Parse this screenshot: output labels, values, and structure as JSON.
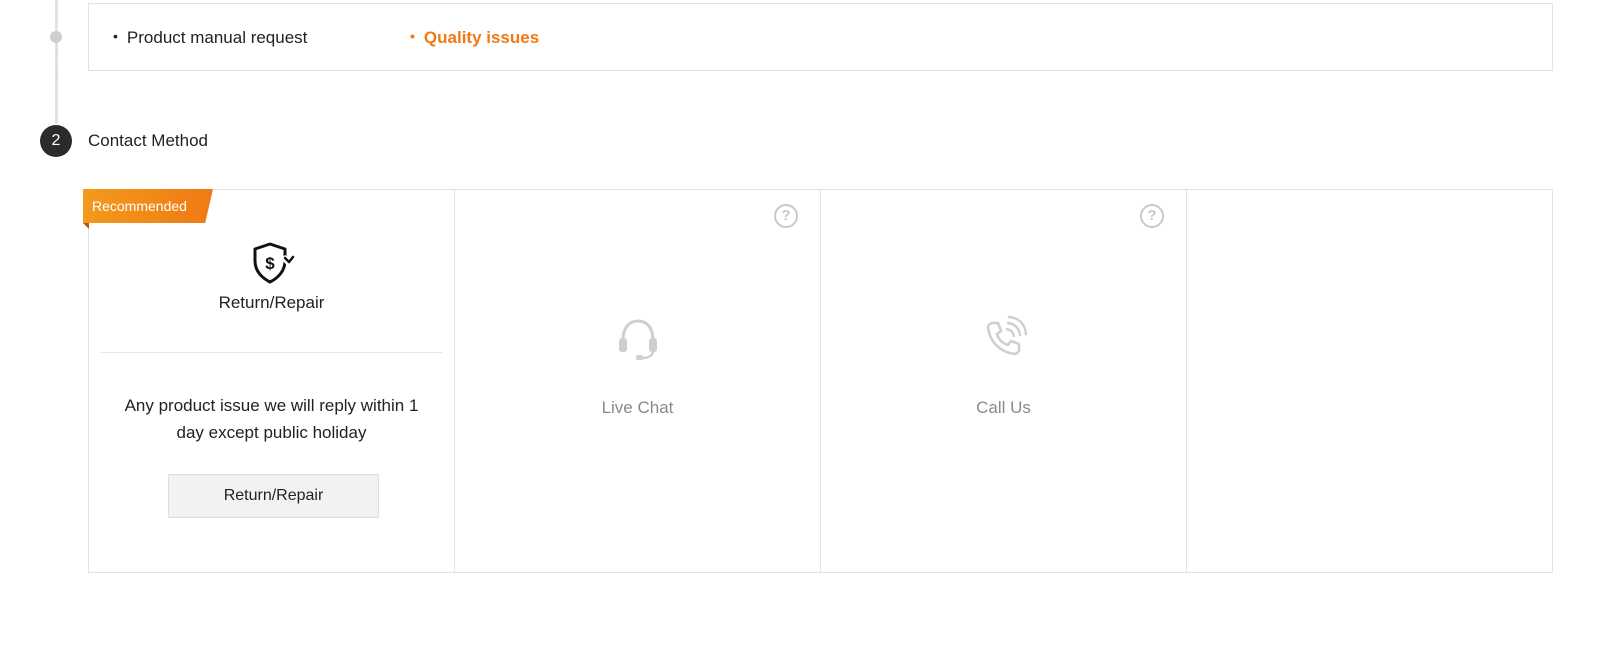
{
  "question_options": [
    {
      "label": "Product manual request",
      "selected": false
    },
    {
      "label": "Quality issues",
      "selected": true
    }
  ],
  "step": {
    "number": "2",
    "label": "Contact Method"
  },
  "contact_methods": [
    {
      "badge": "Recommended",
      "icon": "shield-dollar-refresh-icon",
      "title": "Return/Repair",
      "description": "Any product issue we will reply within 1 day except public holiday",
      "button_label": "Return/Repair"
    },
    {
      "icon": "headset-icon",
      "title": "Live Chat",
      "help": "?"
    },
    {
      "icon": "phone-call-icon",
      "title": "Call Us",
      "help": "?"
    }
  ],
  "colors": {
    "accent": "#f07914",
    "ribbon_start": "#f29a1c",
    "step_badge": "#2b2b2b",
    "border": "#e3e3e3",
    "muted_text": "#8a8a8a"
  }
}
